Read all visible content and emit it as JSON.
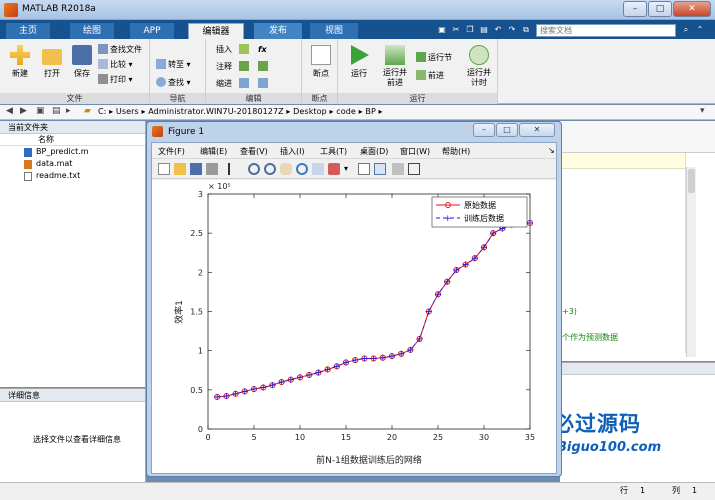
{
  "app": {
    "title": "MATLAB R2018a",
    "window_buttons": {
      "minimize": "–",
      "maximize": "□",
      "close": "✕"
    }
  },
  "tabs": [
    {
      "label": "主页"
    },
    {
      "label": "绘图"
    },
    {
      "label": "APP"
    },
    {
      "label": "编辑器"
    },
    {
      "label": "发布"
    },
    {
      "label": "视图"
    }
  ],
  "search": {
    "placeholder": "搜索文档"
  },
  "ribbon": {
    "file_group": {
      "name": "文件",
      "new": "新建",
      "open": "打开",
      "save": "保存",
      "find_files": "查找文件",
      "compare": "比较",
      "print": "打印"
    },
    "nav_group": {
      "name": "导航",
      "goto": "转至",
      "find": "查找"
    },
    "edit_group": {
      "name": "编辑",
      "insert": "插入",
      "comment": "注释",
      "indent": "缩进",
      "fx": "fx"
    },
    "breakpoint_group": {
      "name": "断点",
      "breakpoint": "断点"
    },
    "run_group": {
      "name": "运行",
      "run": "运行",
      "run_advance": "运行并前进",
      "run_section": "运行节",
      "advance": "前进",
      "run_time": "运行并计时"
    }
  },
  "address": {
    "segments": [
      "C:",
      "Users",
      "Administrator.WIN7U-20180127Z",
      "Desktop",
      "code",
      "BP"
    ]
  },
  "current_folder": {
    "title": "当前文件夹",
    "column_name": "名称",
    "files": [
      {
        "name": "BP_predict.m",
        "icon": "m-file-icon"
      },
      {
        "name": "data.mat",
        "icon": "mat-file-icon"
      },
      {
        "name": "readme.txt",
        "icon": "txt-file-icon"
      }
    ]
  },
  "details": {
    "title": "详细信息",
    "message": "选择文件以查看详细信息"
  },
  "editor_snippets": {
    "line1": "+3)",
    "line2": "个作为预测数据"
  },
  "status": {
    "row_label": "行",
    "row_value": "1",
    "col_label": "列",
    "col_value": "1"
  },
  "watermark": {
    "cn": "必过源码",
    "en": "Biguo100.com"
  },
  "figure": {
    "title": "Figure 1",
    "menu": [
      "文件(F)",
      "编辑(E)",
      "查看(V)",
      "插入(I)",
      "工具(T)",
      "桌面(D)",
      "窗口(W)",
      "帮助(H)"
    ],
    "colors": {
      "original": "#e8141a",
      "trained": "#1c1ee0"
    }
  },
  "chart_data": {
    "type": "line",
    "title": "",
    "xlabel": "前N-1组数据训练后的网络",
    "ylabel": "效率1",
    "y_exponent_label": "× 10⁵",
    "xlim": [
      0,
      35
    ],
    "ylim": [
      0,
      300000
    ],
    "xticks": [
      0,
      5,
      10,
      15,
      20,
      25,
      30,
      35
    ],
    "yticks": [
      0,
      50000,
      100000,
      150000,
      200000,
      250000,
      300000
    ],
    "ytick_labels": [
      "0",
      "0.5",
      "1",
      "1.5",
      "2",
      "2.5",
      "3"
    ],
    "legend_position": "top-right",
    "x": [
      1,
      2,
      3,
      4,
      5,
      6,
      7,
      8,
      9,
      10,
      11,
      12,
      13,
      14,
      15,
      16,
      17,
      18,
      19,
      20,
      21,
      22,
      23,
      24,
      25,
      26,
      27,
      28,
      29,
      30,
      31,
      32,
      33,
      34,
      35
    ],
    "series": [
      {
        "name": "原始数据",
        "marker": "circle",
        "values": [
          41000,
          42000,
          45000,
          48000,
          51000,
          53000,
          56000,
          60000,
          63000,
          66000,
          69000,
          72000,
          76000,
          80000,
          85000,
          88000,
          90000,
          90000,
          91000,
          93000,
          96000,
          101000,
          115000,
          150000,
          172000,
          188000,
          203000,
          210000,
          218000,
          232000,
          250000,
          256000,
          261000,
          262000,
          263000
        ]
      },
      {
        "name": "训练后数据",
        "marker": "plus",
        "values": [
          41000,
          42000,
          45000,
          48000,
          51000,
          53000,
          56000,
          60000,
          63000,
          66000,
          69000,
          72000,
          76000,
          80000,
          85000,
          88000,
          90000,
          90000,
          91000,
          93000,
          96000,
          101000,
          115000,
          150000,
          172000,
          188000,
          203000,
          210000,
          218000,
          232000,
          250000,
          256000,
          261000,
          262000,
          263000
        ]
      }
    ]
  }
}
